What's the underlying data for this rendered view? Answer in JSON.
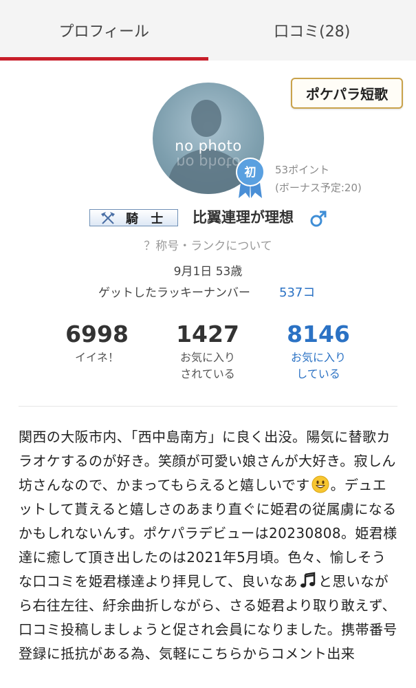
{
  "tabs": [
    {
      "label": "プロフィール",
      "active": true
    },
    {
      "label": "口コミ(28)",
      "active": false
    }
  ],
  "tanka_label": "ポケパラ短歌",
  "avatar": {
    "placeholder": "no photo"
  },
  "badge": {
    "label": "初",
    "color": "#5aa0e0"
  },
  "points": {
    "current": "53ポイント",
    "bonus": "(ボーナス予定:20)"
  },
  "rank": {
    "label": "騎 士",
    "icon": "crossed-axes-icon"
  },
  "profile": {
    "name": "比翼連理が理想",
    "gender_icon": "male-icon",
    "title_rank_link": "？称号・ランクについて",
    "birth_age": "9月1日 53歳",
    "lucky_label": "ゲットしたラッキーナンバー",
    "lucky_value": "537コ"
  },
  "stats": [
    {
      "value": "6998",
      "label_line1": "イイネ！",
      "label_line2": ""
    },
    {
      "value": "1427",
      "label_line1": "お気に入り",
      "label_line2": "されている"
    },
    {
      "value": "8146",
      "label_line1": "お気に入り",
      "label_line2": "している"
    }
  ],
  "bio": {
    "part1": "関西の大阪市内、「西中島南方」に良く出没。陽気に替歌カラオケするのが好き。笑顔が可愛い娘さんが大好き。寂しん坊さんなので、かまってもらえると嬉しいです",
    "part2": "。デュエットして貰えると嬉しさのあまり直ぐに姫君の従属虜になるかもしれないんす。ポケパラデビューは20230808。姫君様達に癒して頂き出したのは2021年5月頃。色々、愉しそうな口コミを姫君様達より拝見して、良いなあ",
    "part3": "と思いながら右往左往、紆余曲折しながら、さる姫君より取り敢えず、口コミ投稿しましょうと促され会員になりました。携帯番号登録に抵抗がある為、気軽にこちらからコメント出来"
  },
  "colors": {
    "accent_red": "#c81e2a",
    "link_blue": "#2b72c4",
    "gold": "#c9a24a"
  }
}
